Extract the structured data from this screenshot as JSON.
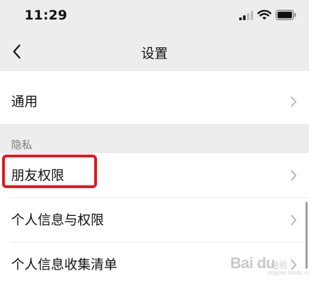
{
  "status_bar": {
    "time": "11:29",
    "icons": [
      "signal-icon",
      "wifi-icon",
      "battery-icon"
    ]
  },
  "header": {
    "back_icon": "chevron-left-icon",
    "title": "设置"
  },
  "settings": {
    "general_label": "通用",
    "privacy_section_title": "隐私",
    "privacy_items": [
      {
        "label": "朋友权限"
      },
      {
        "label": "个人信息与权限"
      },
      {
        "label": "个人信息收集清单"
      }
    ]
  },
  "annotation": {
    "highlight_color": "#e8151b"
  },
  "watermark": {
    "brand": "Bai du",
    "sub": "经验",
    "url": "jingyan.baidu.com"
  },
  "colors": {
    "background": "#ededed",
    "row_background": "#ffffff",
    "chevron": "#b2b2b2"
  }
}
